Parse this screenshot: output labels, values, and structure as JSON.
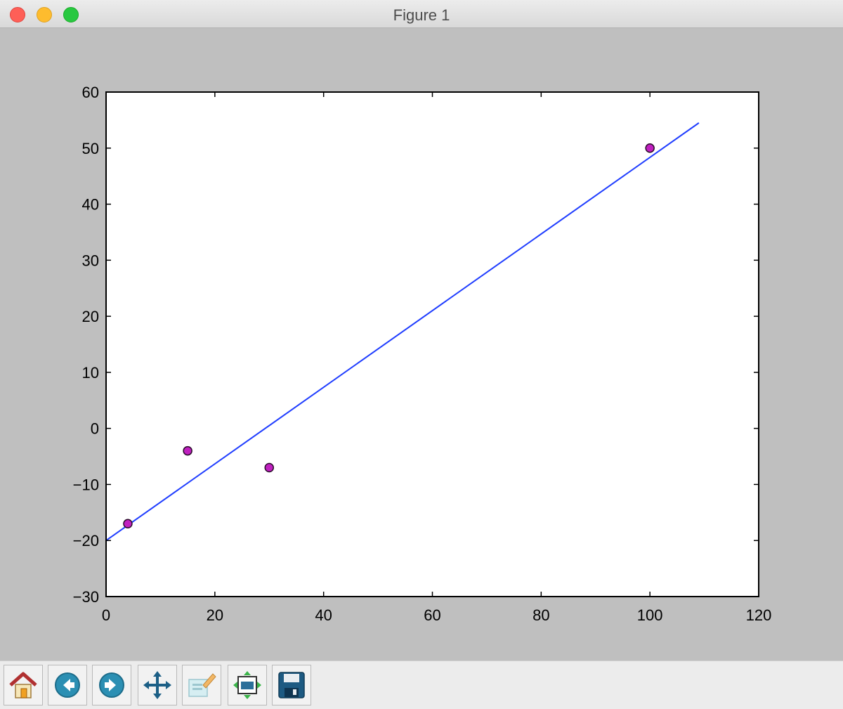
{
  "window": {
    "title": "Figure 1"
  },
  "colors": {
    "line": "#1f3dff",
    "marker_face": "#c020c0",
    "marker_edge": "#2a0a2a",
    "axes_face": "#ffffff",
    "figure_face": "#bfbfbf"
  },
  "toolbar": {
    "buttons": [
      {
        "name": "home",
        "icon": "home-icon"
      },
      {
        "name": "back",
        "icon": "back-arrow-icon"
      },
      {
        "name": "forward",
        "icon": "forward-arrow-icon"
      },
      {
        "name": "pan",
        "icon": "pan-move-icon"
      },
      {
        "name": "zoom-rect",
        "icon": "zoom-rect-icon"
      },
      {
        "name": "subplots",
        "icon": "subplots-configure-icon"
      },
      {
        "name": "save",
        "icon": "save-floppy-icon"
      }
    ]
  },
  "chart_data": {
    "type": "scatter",
    "title": "",
    "xlabel": "",
    "ylabel": "",
    "xlim": [
      0,
      120
    ],
    "ylim": [
      -30,
      60
    ],
    "xticks": [
      0,
      20,
      40,
      60,
      80,
      100,
      120
    ],
    "yticks": [
      -30,
      -20,
      -10,
      0,
      10,
      20,
      30,
      40,
      50,
      60
    ],
    "xtick_labels": [
      "0",
      "20",
      "40",
      "60",
      "80",
      "100",
      "120"
    ],
    "ytick_labels": [
      "−30",
      "−20",
      "−10",
      "0",
      "10",
      "20",
      "30",
      "40",
      "50",
      "60"
    ],
    "grid": false,
    "series": [
      {
        "kind": "scatter",
        "points": [
          {
            "x": 4,
            "y": -17
          },
          {
            "x": 15,
            "y": -4
          },
          {
            "x": 30,
            "y": -7
          },
          {
            "x": 100,
            "y": 50
          }
        ]
      },
      {
        "kind": "line",
        "points": [
          {
            "x": 0,
            "y": -20
          },
          {
            "x": 109,
            "y": 54.5
          }
        ]
      }
    ]
  }
}
